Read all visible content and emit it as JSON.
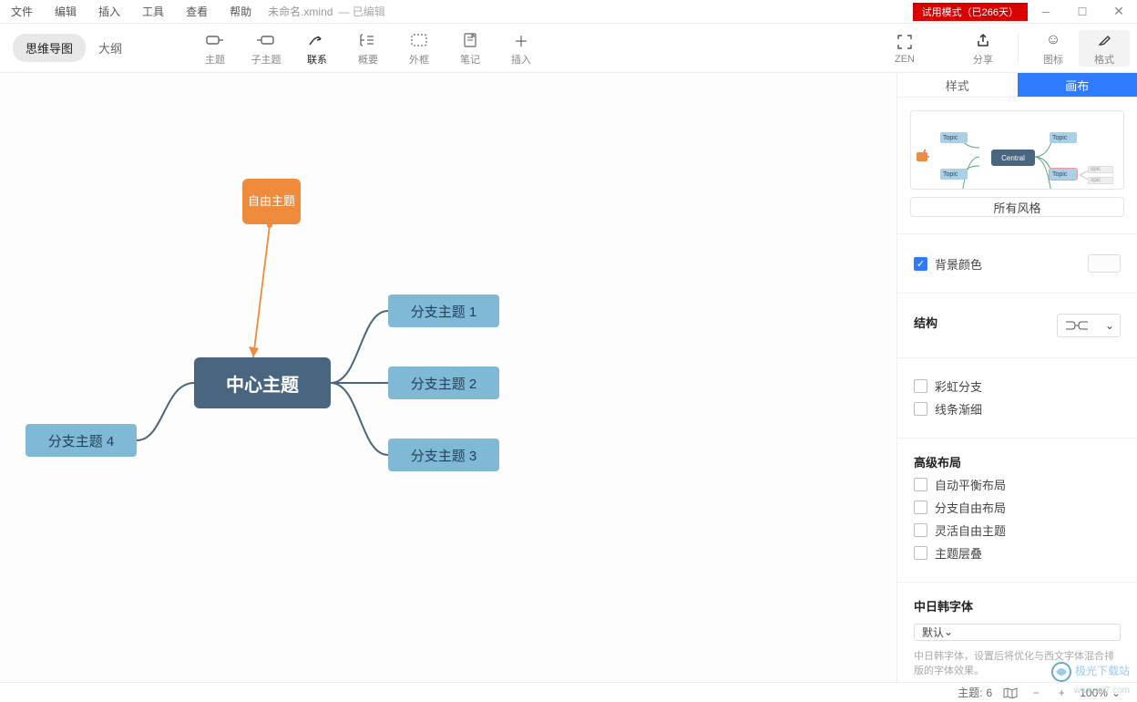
{
  "menubar": [
    "文件",
    "编辑",
    "插入",
    "工具",
    "查看",
    "帮助"
  ],
  "file": {
    "name": "未命名.xmind",
    "status": "— 已编辑"
  },
  "trial_banner": "试用模式（已266天）",
  "view_tabs": {
    "mindmap": "思维导图",
    "outline": "大纲"
  },
  "toolbar": {
    "topic": "主题",
    "subtopic": "子主题",
    "relation": "联系",
    "summary": "概要",
    "boundary": "外框",
    "note": "笔记",
    "insert": "插入",
    "zen": "ZEN",
    "share": "分享",
    "icons": "图标",
    "format": "格式"
  },
  "canvas_nodes": {
    "central": "中心主题",
    "free": "自由主题",
    "branch1": "分支主题 1",
    "branch2": "分支主题 2",
    "branch3": "分支主题 3",
    "branch4": "分支主题 4"
  },
  "sidebar": {
    "tabs": {
      "style": "样式",
      "canvas": "画布"
    },
    "all_styles": "所有风格",
    "bg_color": "背景颜色",
    "structure": "结构",
    "rainbow": "彩虹分支",
    "tapered": "线条渐细",
    "advanced_layout": "高级布局",
    "auto_balance": "自动平衡布局",
    "branch_free": "分支自由布局",
    "flex_topic": "灵活自由主题",
    "overlap": "主题层叠",
    "cjk_font": "中日韩字体",
    "font_default": "默认",
    "font_hint": "中日韩字体，设置后将优化与西文字体混合排版的字体效果。",
    "preview_central": "Central",
    "preview_topic": "Topic",
    "preview_sub": "opic"
  },
  "statusbar": {
    "topic_count_label": "主题:",
    "topic_count": "6",
    "zoom": "100%",
    "chevron": "⌄"
  },
  "watermark": {
    "main": "极光下载站",
    "sub": "www.xz7.com"
  }
}
